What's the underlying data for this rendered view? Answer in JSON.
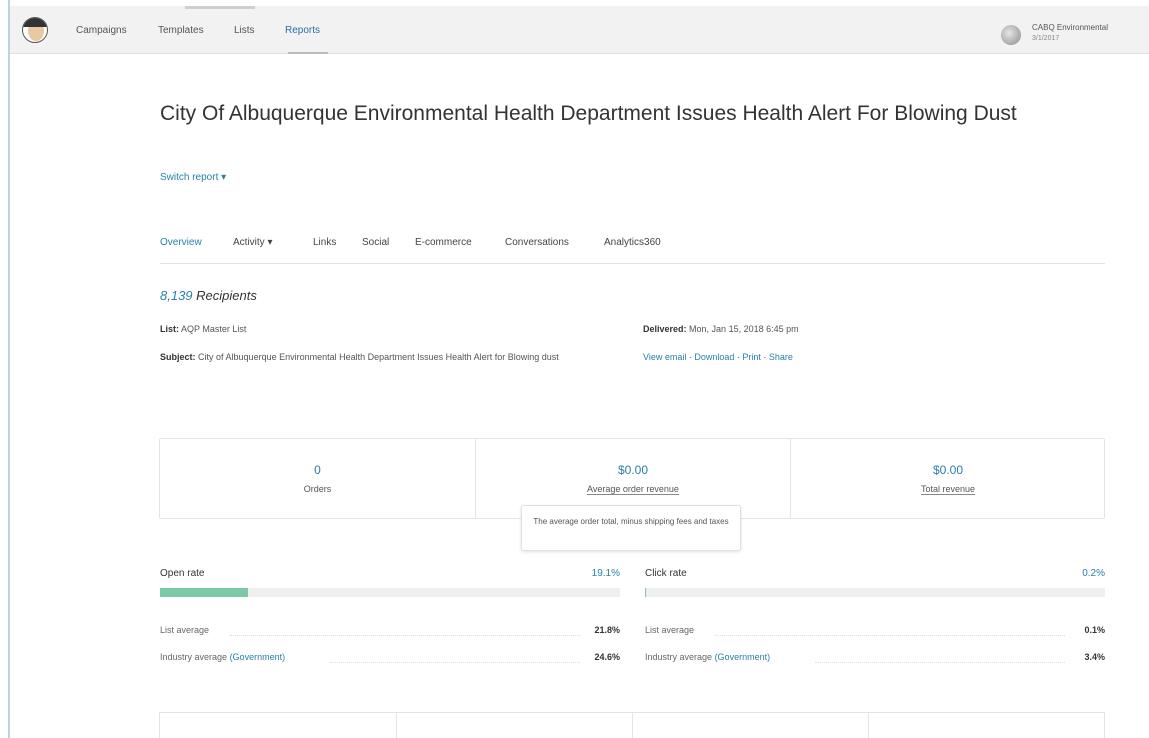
{
  "nav": {
    "items": [
      "Campaigns",
      "Templates",
      "Lists",
      "Reports"
    ],
    "active": "Reports",
    "account_name": "CABQ Environmental",
    "account_sub": "3/1/2017"
  },
  "report": {
    "title": "City Of Albuquerque Environmental Health Department Issues Health Alert For Blowing Dust",
    "switch_label": "Switch report ▾"
  },
  "tabs": [
    "Overview",
    "Activity ▾",
    "Links",
    "Social",
    "E-commerce",
    "Conversations",
    "Analytics360"
  ],
  "summary": {
    "recipients_count": "8,139",
    "recipients_label": "Recipients",
    "list_label": "List:",
    "list_value": "AQP Master List",
    "subject_label": "Subject:",
    "subject_value": "City of Albuquerque Environmental Health Department Issues Health Alert for Blowing dust",
    "delivered_label": "Delivered:",
    "delivered_value": "Mon, Jan 15, 2018 6:45 pm",
    "links": [
      "View email",
      "Download",
      "Print",
      "Share"
    ],
    "link_sep": " · "
  },
  "stats": [
    {
      "value": "0",
      "label": "Orders"
    },
    {
      "value": "$0.00",
      "label": "Average order revenue"
    },
    {
      "value": "$0.00",
      "label": "Total revenue"
    }
  ],
  "tooltip": "The average order total, minus shipping fees and taxes",
  "open_rate": {
    "label": "Open rate",
    "value": "19.1%",
    "fraction": 0.191,
    "list_avg_label": "List average",
    "list_avg_value": "21.8%",
    "industry_label": "Industry average",
    "industry_link": "(Government)",
    "industry_value": "24.6%"
  },
  "click_rate": {
    "label": "Click rate",
    "value": "0.2%",
    "fraction": 0.002,
    "list_avg_label": "List average",
    "list_avg_value": "0.1%",
    "industry_label": "Industry average",
    "industry_link": "(Government)",
    "industry_value": "3.4%"
  },
  "colors": {
    "accent": "#2a7fa8",
    "bar_fill": "#7cc9a7"
  }
}
